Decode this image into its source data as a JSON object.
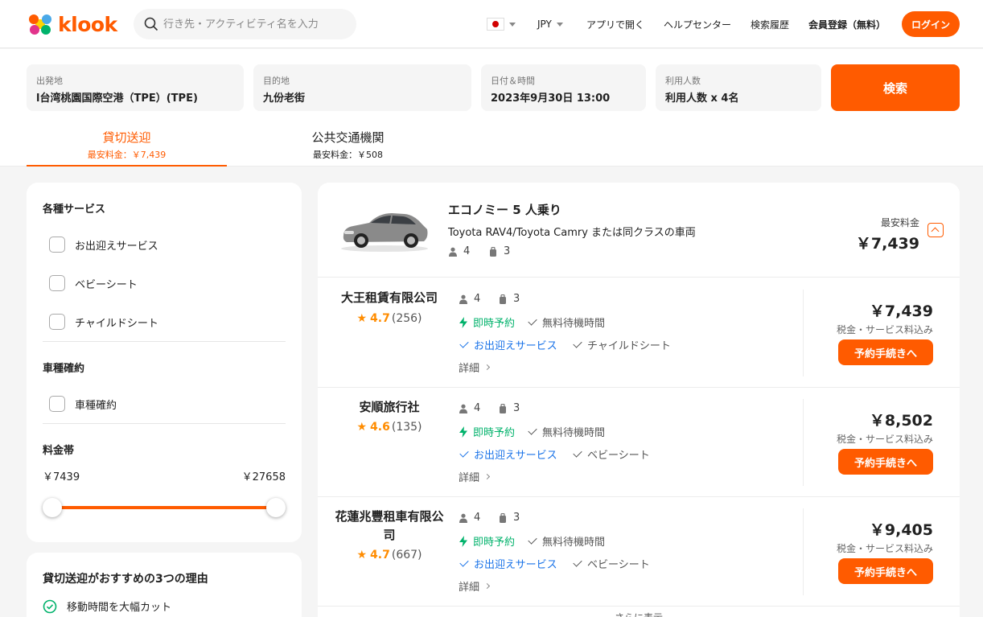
{
  "header": {
    "logo_text": "klook",
    "search_placeholder": "行き先・アクティビティ名を入力",
    "currency": "JPY",
    "nav": [
      "アプリで開く",
      "ヘルプセンター",
      "検索履歴",
      "会員登録（無料）"
    ],
    "login": "ログイン"
  },
  "form": {
    "origin": {
      "label": "出発地",
      "value": "l台湾桃園国際空港（TPE）(TPE)"
    },
    "destination": {
      "label": "目的地",
      "value": "九份老街"
    },
    "datetime": {
      "label": "日付＆時間",
      "value": "2023年9月30日 13:00"
    },
    "passengers": {
      "label": "利用人数",
      "value": "利用人数 x 4名"
    },
    "search": "検索"
  },
  "tabs": [
    {
      "title": "貸切送迎",
      "price": "最安料金：￥7,439",
      "active": true
    },
    {
      "title": "公共交通機関",
      "price": "最安料金：￥508",
      "active": false
    }
  ],
  "filters": {
    "services_title": "各種サービス",
    "services": [
      "お出迎えサービス",
      "ベビーシート",
      "チャイルドシート"
    ],
    "vehicle_title": "車種確約",
    "vehicle_option": "車種確約",
    "price_title": "料金帯",
    "price_min": "￥7439",
    "price_max": "￥27658"
  },
  "recommend": {
    "title": "貸切送迎がおすすめの3つの理由",
    "reason1": "移動時間を大幅カット"
  },
  "car": {
    "name": "エコノミー 5 人乗り",
    "models": "Toyota RAV4/Toyota Camry または同クラスの車両",
    "passengers": "4",
    "luggage": "3",
    "lowest_label": "最安料金",
    "lowest_price": "￥7,439"
  },
  "vendors": [
    {
      "name": "大王租賃有限公司",
      "score": "4.7",
      "count": "(256)",
      "passengers": "4",
      "luggage": "3",
      "instant": "即時予約",
      "wait": "無料待機時間",
      "pickup": "お出迎えサービス",
      "extra": "チャイルドシート",
      "details": "詳細",
      "price": "￥7,439",
      "tax": "税金・サービス料込み",
      "book": "予約手続きへ"
    },
    {
      "name": "安順旅行社",
      "score": "4.6",
      "count": "(135)",
      "passengers": "4",
      "luggage": "3",
      "instant": "即時予約",
      "wait": "無料待機時間",
      "pickup": "お出迎えサービス",
      "extra": "ベビーシート",
      "details": "詳細",
      "price": "￥8,502",
      "tax": "税金・サービス料込み",
      "book": "予約手続きへ"
    },
    {
      "name": "花蓮兆豐租車有限公司",
      "score": "4.7",
      "count": "(667)",
      "passengers": "4",
      "luggage": "3",
      "instant": "即時予約",
      "wait": "無料待機時間",
      "pickup": "お出迎えサービス",
      "extra": "ベビーシート",
      "details": "詳細",
      "price": "￥9,405",
      "tax": "税金・サービス料込み",
      "book": "予約手続きへ"
    }
  ],
  "more": "さらに表示",
  "colors": {
    "accent": "#ff5b00",
    "blue": "#1a73e8",
    "star": "#ff8c00"
  }
}
